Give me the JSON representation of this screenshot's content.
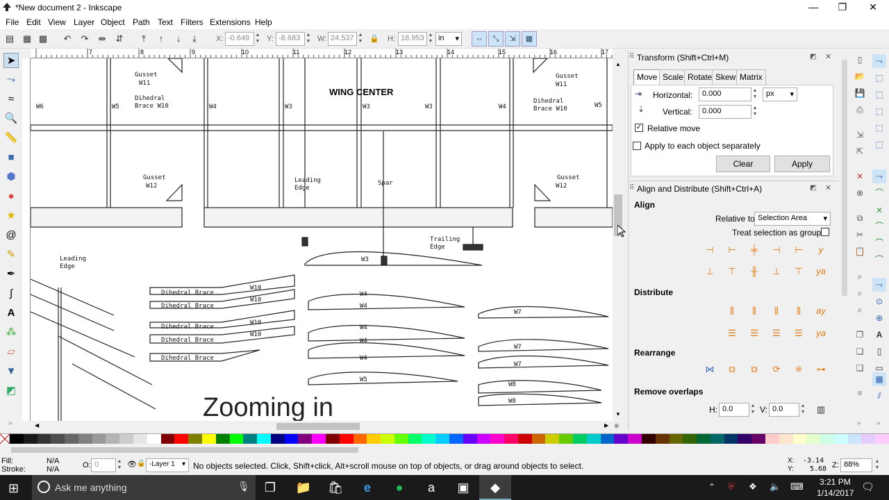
{
  "window": {
    "title": "*New document 2 - Inkscape",
    "min": "—",
    "max": "❐",
    "close": "✕"
  },
  "menu": [
    "File",
    "Edit",
    "View",
    "Layer",
    "Object",
    "Path",
    "Text",
    "Filters",
    "Extensions",
    "Help"
  ],
  "toolbar": {
    "x_label": "X:",
    "x_value": "-0.649",
    "y_label": "Y:",
    "y_value": "-8.683",
    "w_label": "W:",
    "w_value": "24.537",
    "h_label": "H:",
    "h_value": "18.953",
    "unit": "in"
  },
  "ruler_ticks": [
    "6",
    "7",
    "8",
    "9",
    "10",
    "11",
    "12",
    "13",
    "14",
    "15",
    "16",
    "17"
  ],
  "canvas": {
    "wing_center": "WING CENTER",
    "gusset_w11": "Gusset",
    "w11": "W11",
    "dihedral": "Dihedral",
    "brace_w10": "Brace W10",
    "w6": "W6",
    "w5": "W5",
    "w4": "W4",
    "w3": "W3",
    "gusset": "Gusset",
    "w12": "W12",
    "leading": "Leading",
    "edge": "Edge",
    "spar": "Spar",
    "trailing": "Trailing",
    "dihedral_brace": "Dihedral Brace",
    "w10": "W10",
    "w7": "W7",
    "w8": "W8",
    "overlay": "Zooming in"
  },
  "transform": {
    "title": "Transform (Shift+Ctrl+M)",
    "tabs": [
      "Move",
      "Scale",
      "Rotate",
      "Skew",
      "Matrix"
    ],
    "horizontal_label": "Horizontal:",
    "horizontal_value": "0.000",
    "vertical_label": "Vertical:",
    "vertical_value": "0.000",
    "unit": "px",
    "relative_move": "Relative move",
    "apply_each": "Apply to each object separately",
    "clear": "Clear",
    "apply": "Apply"
  },
  "align": {
    "title": "Align and Distribute (Shift+Ctrl+A)",
    "align_section": "Align",
    "relative_to_label": "Relative to:",
    "relative_to_value": "Selection Area",
    "treat_group": "Treat selection as group:",
    "distribute": "Distribute",
    "rearrange": "Rearrange",
    "remove_overlaps": "Remove overlaps",
    "h_label": "H:",
    "h_value": "0.0",
    "v_label": "V:",
    "v_value": "0.0"
  },
  "status": {
    "fill_label": "Fill:",
    "fill_value": "N/A",
    "stroke_label": "Stroke:",
    "stroke_value": "N/A",
    "opacity_label": "O:",
    "opacity_value": "0",
    "layer": "-Layer 1",
    "message": "No objects selected. Click, Shift+click, Alt+scroll mouse on top of objects, or drag around objects to select.",
    "x_label": "X:",
    "x_value": "-3.14",
    "y_label": "Y:",
    "y_value": "5.68",
    "zoom_label": "Z:",
    "zoom_value": "88%"
  },
  "taskbar": {
    "search": "Ask me anything",
    "time": "3:21 PM",
    "date": "1/14/2017"
  },
  "palette": [
    "#000000",
    "#1a1a1a",
    "#333333",
    "#4d4d4d",
    "#666666",
    "#808080",
    "#999999",
    "#b3b3b3",
    "#cccccc",
    "#e6e6e6",
    "#ffffff",
    "#800000",
    "#ff0000",
    "#808000",
    "#ffff00",
    "#008000",
    "#00ff00",
    "#008080",
    "#00ffff",
    "#000080",
    "#0000ff",
    "#800080",
    "#ff00ff",
    "#800000",
    "#ff0000",
    "#ff6600",
    "#ffcc00",
    "#ccff00",
    "#66ff00",
    "#00ff66",
    "#00ffcc",
    "#00ccff",
    "#0066ff",
    "#6600ff",
    "#cc00ff",
    "#ff00cc",
    "#ff0066",
    "#cc0000",
    "#cc6600",
    "#cccc00",
    "#66cc00",
    "#00cc66",
    "#00cccc",
    "#0066cc",
    "#6600cc",
    "#cc00cc",
    "#330000",
    "#663300",
    "#666600",
    "#336600",
    "#006633",
    "#006666",
    "#003366",
    "#330066",
    "#660066",
    "#ffcccc",
    "#ffe5cc",
    "#ffffcc",
    "#e5ffcc",
    "#ccffe5",
    "#ccffff",
    "#cce5ff",
    "#e5ccff",
    "#ffccff"
  ]
}
